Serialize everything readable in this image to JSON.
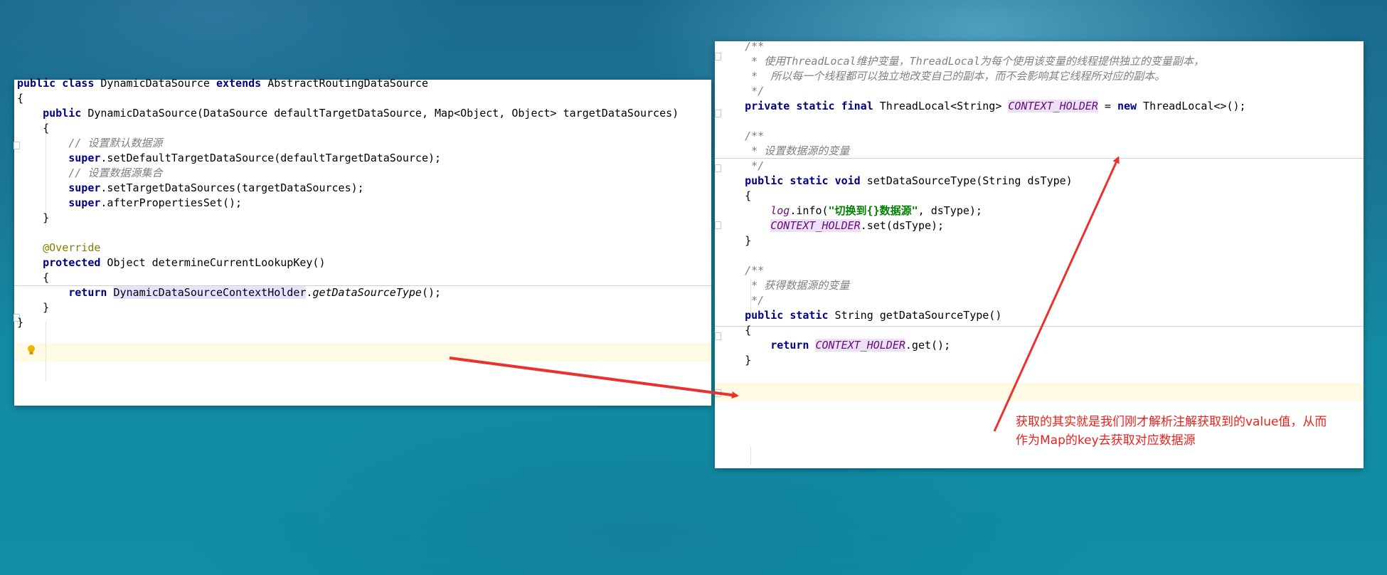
{
  "left_panel": {
    "lines": [
      {
        "parts": [
          {
            "t": "public",
            "c": "kw"
          },
          {
            "t": " "
          },
          {
            "t": "class",
            "c": "kw"
          },
          {
            "t": " DynamicDataSource "
          },
          {
            "t": "extends",
            "c": "kw"
          },
          {
            "t": " AbstractRoutingDataSource"
          }
        ]
      },
      {
        "parts": [
          {
            "t": "{"
          }
        ]
      },
      {
        "parts": [
          {
            "t": "    "
          },
          {
            "t": "public",
            "c": "kw"
          },
          {
            "t": " DynamicDataSource(DataSource defaultTargetDataSource, Map<Object, Object> targetDataSources)"
          }
        ]
      },
      {
        "parts": [
          {
            "t": "    {"
          }
        ]
      },
      {
        "parts": [
          {
            "t": "        "
          },
          {
            "t": "// 设置默认数据源",
            "c": "cm"
          }
        ]
      },
      {
        "parts": [
          {
            "t": "        "
          },
          {
            "t": "super",
            "c": "kw"
          },
          {
            "t": ".setDefaultTargetDataSource(defaultTargetDataSource);"
          }
        ]
      },
      {
        "parts": [
          {
            "t": "        "
          },
          {
            "t": "// 设置数据源集合",
            "c": "cm"
          }
        ]
      },
      {
        "parts": [
          {
            "t": "        "
          },
          {
            "t": "super",
            "c": "kw"
          },
          {
            "t": ".setTargetDataSources(targetDataSources);"
          }
        ]
      },
      {
        "parts": [
          {
            "t": "        "
          },
          {
            "t": "super",
            "c": "kw"
          },
          {
            "t": ".afterPropertiesSet();"
          }
        ]
      },
      {
        "parts": [
          {
            "t": "    }"
          }
        ]
      },
      {
        "parts": []
      },
      {
        "parts": [
          {
            "t": "    "
          },
          {
            "t": "@Override",
            "c": "ann"
          }
        ]
      },
      {
        "parts": [
          {
            "t": "    "
          },
          {
            "t": "protected",
            "c": "kw"
          },
          {
            "t": " Object determineCurrentLookupKey()"
          }
        ]
      },
      {
        "parts": [
          {
            "t": "    {"
          }
        ]
      },
      {
        "parts": [
          {
            "t": "        "
          },
          {
            "t": "return",
            "c": "kw"
          },
          {
            "t": " "
          },
          {
            "t": "DynamicDataSourceConte",
            "c": "hlb"
          },
          {
            "t": "CARET"
          },
          {
            "t": "xtHolder",
            "c": "hlb"
          },
          {
            "t": "."
          },
          {
            "t": "getDataSourceType",
            "c": "it"
          },
          {
            "t": "();"
          }
        ]
      },
      {
        "parts": [
          {
            "t": "    }"
          }
        ]
      },
      {
        "parts": [
          {
            "t": "}"
          }
        ]
      }
    ]
  },
  "right_panel": {
    "lines": [
      {
        "parts": [
          {
            "t": "    "
          },
          {
            "t": "/**",
            "c": "cm"
          }
        ]
      },
      {
        "parts": [
          {
            "t": "     "
          },
          {
            "t": "* 使用ThreadLocal维护变量，ThreadLocal为每个使用该变量的线程提供独立的变量副本，",
            "c": "cm"
          }
        ]
      },
      {
        "parts": [
          {
            "t": "     "
          },
          {
            "t": "*  所以每一个线程都可以独立地改变自己的副本，而不会影响其它线程所对应的副本。",
            "c": "cm"
          }
        ]
      },
      {
        "parts": [
          {
            "t": "     "
          },
          {
            "t": "*/",
            "c": "cm"
          }
        ]
      },
      {
        "parts": [
          {
            "t": "    "
          },
          {
            "t": "private",
            "c": "kw"
          },
          {
            "t": " "
          },
          {
            "t": "static",
            "c": "kw"
          },
          {
            "t": " "
          },
          {
            "t": "final",
            "c": "kw"
          },
          {
            "t": " ThreadLocal<String> "
          },
          {
            "t": "CONTEXT_HOLDER",
            "c": "static hl"
          },
          {
            "t": " = "
          },
          {
            "t": "new",
            "c": "kw"
          },
          {
            "t": " ThreadLocal<>();"
          }
        ]
      },
      {
        "parts": []
      },
      {
        "parts": [
          {
            "t": "    "
          },
          {
            "t": "/**",
            "c": "cm"
          }
        ]
      },
      {
        "parts": [
          {
            "t": "     "
          },
          {
            "t": "* 设置数据源的变量",
            "c": "cm"
          }
        ]
      },
      {
        "parts": [
          {
            "t": "     "
          },
          {
            "t": "*/",
            "c": "cm"
          }
        ]
      },
      {
        "parts": [
          {
            "t": "    "
          },
          {
            "t": "public",
            "c": "kw"
          },
          {
            "t": " "
          },
          {
            "t": "static",
            "c": "kw"
          },
          {
            "t": " "
          },
          {
            "t": "void",
            "c": "kw"
          },
          {
            "t": " setDataSourceType(String dsType)"
          }
        ]
      },
      {
        "parts": [
          {
            "t": "    {"
          }
        ]
      },
      {
        "parts": [
          {
            "t": "        "
          },
          {
            "t": "log",
            "c": "static"
          },
          {
            "t": ".info("
          },
          {
            "t": "\"切换到{}数据源\"",
            "c": "str"
          },
          {
            "t": ", dsType);"
          }
        ]
      },
      {
        "parts": [
          {
            "t": "        "
          },
          {
            "t": "CONTEXT_HOLDER",
            "c": "static hl"
          },
          {
            "t": ".set(dsType);"
          }
        ]
      },
      {
        "parts": [
          {
            "t": "    }"
          }
        ]
      },
      {
        "parts": []
      },
      {
        "parts": [
          {
            "t": "    "
          },
          {
            "t": "/**",
            "c": "cm"
          }
        ]
      },
      {
        "parts": [
          {
            "t": "     "
          },
          {
            "t": "* 获得数据源的变量",
            "c": "cm"
          }
        ]
      },
      {
        "parts": [
          {
            "t": "     "
          },
          {
            "t": "*/",
            "c": "cm"
          }
        ]
      },
      {
        "parts": [
          {
            "t": "    "
          },
          {
            "t": "public",
            "c": "kw"
          },
          {
            "t": " "
          },
          {
            "t": "static",
            "c": "kw"
          },
          {
            "t": " String getDataSourceType()"
          }
        ]
      },
      {
        "parts": [
          {
            "t": "    {"
          }
        ]
      },
      {
        "parts": [
          {
            "t": "        "
          },
          {
            "t": "return",
            "c": "kw"
          },
          {
            "t": " "
          },
          {
            "t": "CONTEXT_HOLDER",
            "c": "static hl"
          },
          {
            "t": ".get();"
          }
        ]
      },
      {
        "parts": [
          {
            "t": "    }"
          }
        ]
      }
    ]
  },
  "annotation": {
    "line1": "获取的其实就是我们刚才解析注解获取到的value值，从而",
    "line2": "作为Map的key去获取对应数据源"
  },
  "colors": {
    "keyword": "#000080",
    "comment": "#808080",
    "annotation_text": "#e8221f",
    "arrow": "#e8322f"
  }
}
